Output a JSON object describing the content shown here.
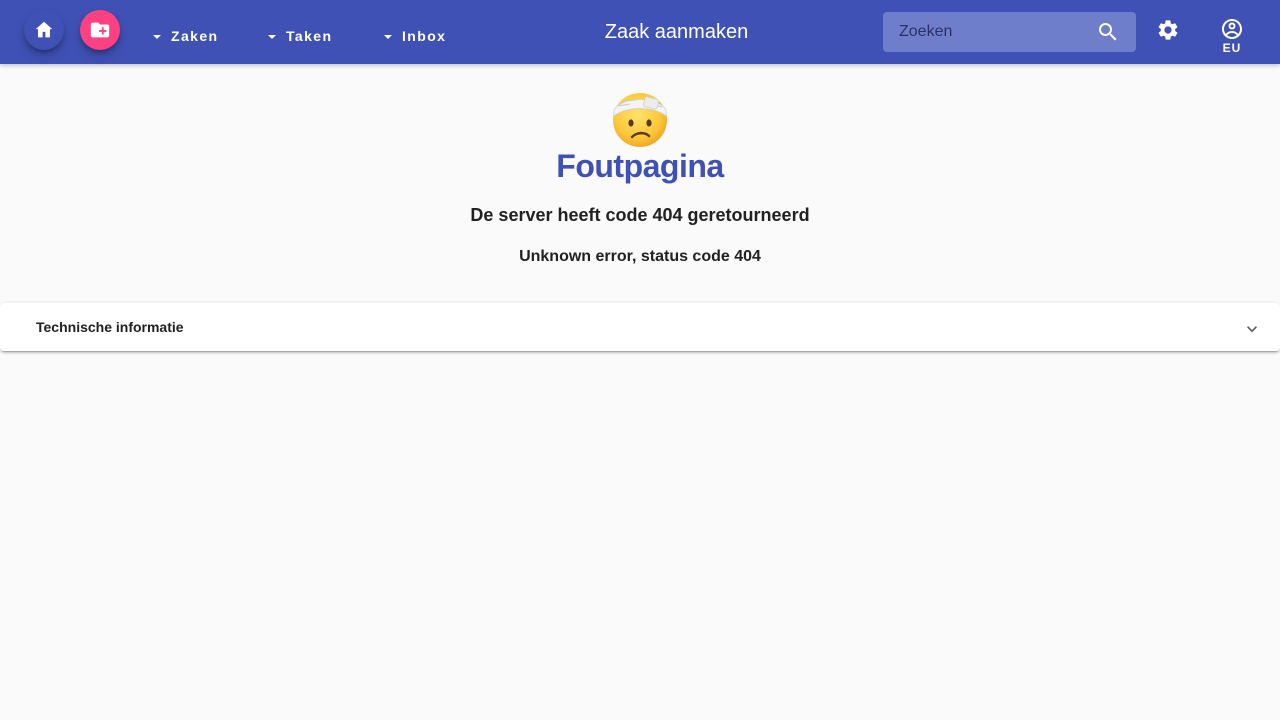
{
  "toolbar": {
    "home_icon": "home-icon",
    "create_icon": "create-folder-icon",
    "nav": [
      {
        "label": "Zaken"
      },
      {
        "label": "Taken"
      },
      {
        "label": "Inbox"
      }
    ],
    "title": "Zaak aanmaken",
    "search": {
      "placeholder": "Zoeken",
      "value": ""
    },
    "settings_icon": "gear-icon",
    "user": {
      "initials": "EU",
      "icon": "account-circle-icon"
    }
  },
  "error": {
    "emoji": "face-with-head-bandage",
    "title": "Foutpagina",
    "subtitle": "De server heeft code 404 geretourneerd",
    "message": "Unknown error, status code 404"
  },
  "panel": {
    "title": "Technische informatie",
    "expanded": false
  },
  "colors": {
    "primary": "#3f51b5",
    "accent": "#ff4081",
    "background": "#fafafa"
  }
}
